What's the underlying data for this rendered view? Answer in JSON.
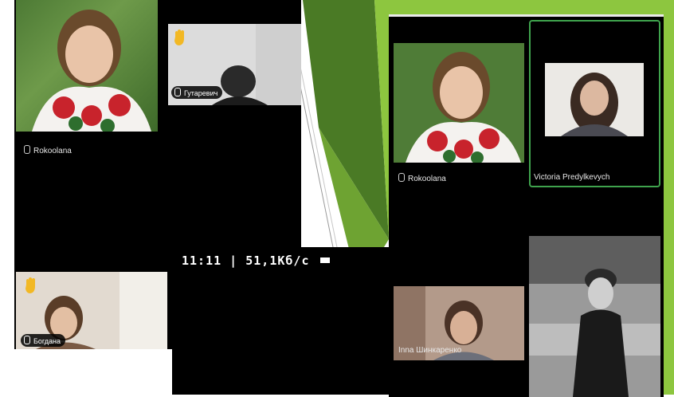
{
  "screenshot_left": {
    "participants": [
      {
        "name": "Rokoolana",
        "hand_raised": false
      },
      {
        "name": "Гутаревич",
        "hand_raised": true
      },
      {
        "name": "Богдана",
        "hand_raised": true
      }
    ]
  },
  "status_bar": {
    "time_speed": "11:11 | 51,1Кб/с",
    "icon": "camera-icon"
  },
  "screenshot_right": {
    "participants": [
      {
        "name": "Rokoolana",
        "active_speaker": false
      },
      {
        "name": "Victoria Predylkevych",
        "active_speaker": true
      },
      {
        "name": "Inna Шинкаренко",
        "active_speaker": false
      }
    ],
    "active_speaker_color": "#3fa34d"
  },
  "colors": {
    "green_light": "#8dc63f",
    "green_dark": "#4a7a25",
    "background": "#ffffff"
  }
}
